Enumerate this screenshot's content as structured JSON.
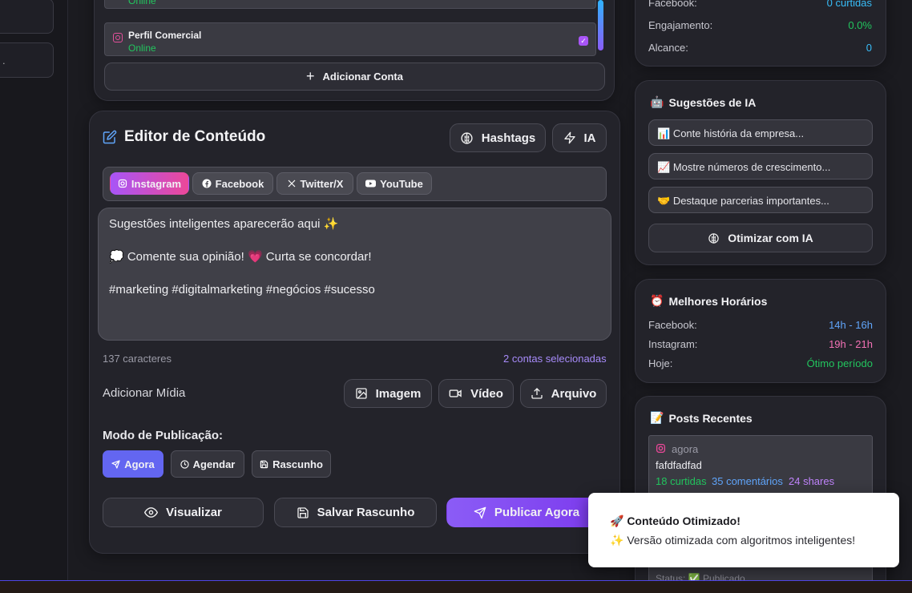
{
  "accounts": {
    "items": [
      {
        "name": "",
        "status": "Online"
      },
      {
        "name": "Perfil Comercial",
        "status": "Online"
      }
    ],
    "add_label": "Adicionar Conta"
  },
  "editor": {
    "title": "Editor de Conteúdo",
    "hashtags_label": "Hashtags",
    "ia_label": "IA",
    "platforms": [
      {
        "label": "Instagram",
        "active": true
      },
      {
        "label": "Facebook",
        "active": false
      },
      {
        "label": "Twitter/X",
        "active": false
      },
      {
        "label": "YouTube",
        "active": false
      }
    ],
    "content_lines": [
      "Sugestões inteligentes aparecerão aqui ✨",
      "",
      "💭 Comente sua opinião! 💗 Curta se concordar!",
      "",
      "#marketing #digitalmarketing #negócios #sucesso"
    ],
    "char_count": "137 caracteres",
    "selected_accounts": "2 contas selecionadas",
    "media_label": "Adicionar Mídia",
    "media_buttons": {
      "image": "Imagem",
      "video": "Vídeo",
      "file": "Arquivo"
    },
    "mode_label": "Modo de Publicação:",
    "modes": {
      "now": "Agora",
      "schedule": "Agendar",
      "draft": "Rascunho"
    },
    "actions": {
      "preview": "Visualizar",
      "save_draft": "Salvar Rascunho",
      "publish": "Publicar Agora"
    }
  },
  "stats": {
    "rows": [
      {
        "label": "Facebook:",
        "value": "0 curtidas",
        "color": "#38bdf8"
      },
      {
        "label": "Engajamento:",
        "value": "0.0%",
        "color": "#22c55e"
      },
      {
        "label": "Alcance:",
        "value": "0",
        "color": "#38bdf8"
      }
    ]
  },
  "suggestions": {
    "title": "Sugestões de IA",
    "icon": "🤖",
    "items": [
      {
        "icon": "📊",
        "text": "Conte história da empresa..."
      },
      {
        "icon": "📈",
        "text": "Mostre números de crescimento..."
      },
      {
        "icon": "🤝",
        "text": "Destaque parcerias importantes..."
      }
    ],
    "optimize_label": "Otimizar com IA"
  },
  "best_hours": {
    "title": "Melhores Horários",
    "icon": "⏰",
    "rows": [
      {
        "label": "Facebook:",
        "value": "14h - 16h",
        "color": "#60a5fa"
      },
      {
        "label": "Instagram:",
        "value": "19h - 21h",
        "color": "#f472b6"
      },
      {
        "label": "Hoje:",
        "value": "Ótimo período",
        "color": "#22c55e"
      }
    ]
  },
  "recent_posts": {
    "title": "Posts Recentes",
    "icon": "📝",
    "post": {
      "time": "agora",
      "text": "fafdfadfad",
      "likes": "18 curtidas",
      "comments": "35 comentários",
      "shares": "24 shares",
      "status": "Status: ✅ Publicado"
    }
  },
  "toast": {
    "title": "🚀 Conteúdo Otimizado!",
    "message": "✨ Versão otimizada com algoritmos inteligentes!"
  },
  "colors": {
    "accent": "#8b5cf6",
    "online": "#22c55e",
    "instagram": "#ec4899",
    "mode_active": "#6366f1"
  }
}
